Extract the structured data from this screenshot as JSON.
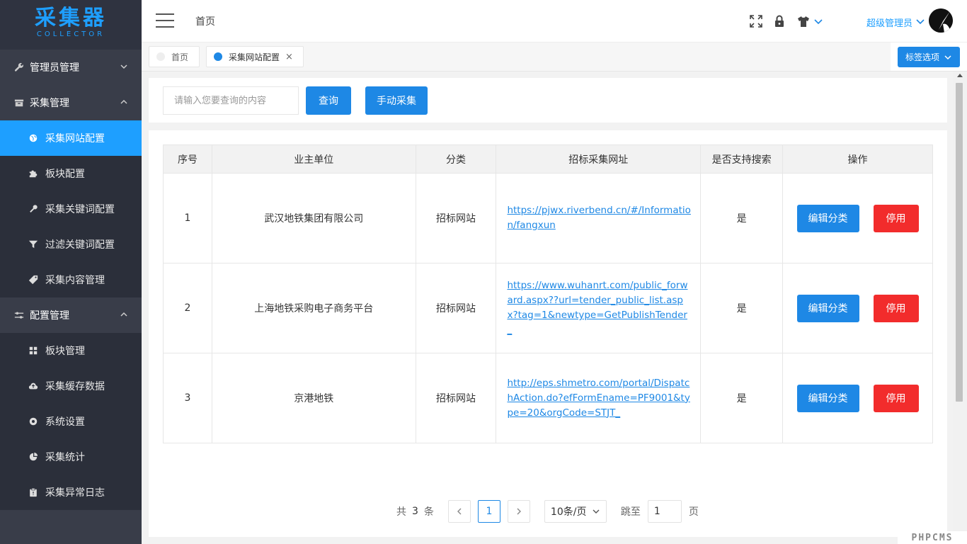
{
  "app": {
    "logo_title": "采集器",
    "logo_sub": "COLLECTOR"
  },
  "sidebar": {
    "groups": [
      {
        "label": "管理员管理",
        "icon": "wrench-icon",
        "expanded": false
      },
      {
        "label": "采集管理",
        "icon": "inbox-icon",
        "expanded": true,
        "items": [
          {
            "label": "采集网站配置",
            "icon": "globe-icon",
            "active": true
          },
          {
            "label": "板块配置",
            "icon": "puzzle-icon"
          },
          {
            "label": "采集关键词配置",
            "icon": "key-icon"
          },
          {
            "label": "过滤关键词配置",
            "icon": "filter-icon"
          },
          {
            "label": "采集内容管理",
            "icon": "tag-icon"
          }
        ]
      },
      {
        "label": "配置管理",
        "icon": "sliders-icon",
        "expanded": true,
        "items": [
          {
            "label": "板块管理",
            "icon": "grid-icon"
          },
          {
            "label": "采集缓存数据",
            "icon": "cloud-upload-icon"
          },
          {
            "label": "系统设置",
            "icon": "gear-icon"
          },
          {
            "label": "采集统计",
            "icon": "pie-chart-icon"
          },
          {
            "label": "采集异常日志",
            "icon": "clipboard-icon"
          }
        ]
      }
    ]
  },
  "header": {
    "breadcrumb": "首页",
    "user": "超级管理员"
  },
  "tabs": [
    {
      "label": "首页",
      "active": false
    },
    {
      "label": "采集网站配置",
      "active": true,
      "close": "×"
    }
  ],
  "tab_options": "标签选项",
  "search": {
    "placeholder": "请输入您要查询的内容",
    "query_button": "查询",
    "manual_button": "手动采集"
  },
  "table": {
    "headers": [
      "序号",
      "业主单位",
      "分类",
      "招标采集网址",
      "是否支持搜索",
      "操作"
    ],
    "rows": [
      {
        "no": "1",
        "owner": "武汉地铁集团有限公司",
        "category": "招标网站",
        "url": "https://pjwx.riverbend.cn/#/Information/fangxun",
        "search": "是",
        "edit": "编辑分类",
        "disable": "停用"
      },
      {
        "no": "2",
        "owner": "上海地铁采购电子商务平台",
        "category": "招标网站",
        "url": "https://www.wuhanrt.com/public_forward.aspx??url=tender_public_list.aspx?tag=1&newtype=GetPublishTender_",
        "search": "是",
        "edit": "编辑分类",
        "disable": "停用"
      },
      {
        "no": "3",
        "owner": "京港地铁",
        "category": "招标网站",
        "url": "http://eps.shmetro.com/portal/DispatchAction.do?efFormEname=PF9001&type=20&orgCode=STJT_",
        "search": "是",
        "edit": "编辑分类",
        "disable": "停用"
      }
    ]
  },
  "pagination": {
    "total_prefix": "共",
    "total": "3",
    "total_suffix": "条",
    "current_page": "1",
    "page_size": "10条/页",
    "jump_label": "跳至",
    "jump_value": "1",
    "page_suffix": "页"
  },
  "watermark": "PHPCMS",
  "colors": {
    "accent": "#1e88e5",
    "danger": "#f22c2c",
    "sidebar": "#393d49",
    "sidebar_sub": "#2b2f3a"
  }
}
